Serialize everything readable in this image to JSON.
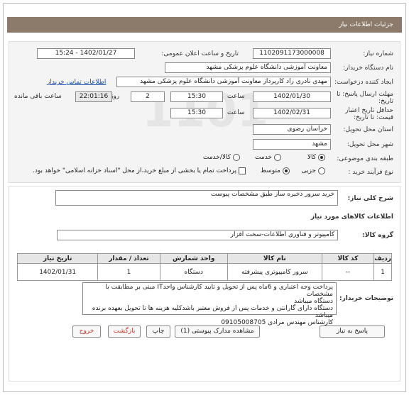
{
  "header": {
    "title": "جزئیات اطلاعات نیاز"
  },
  "form": {
    "need_number": {
      "label": "شماره نیاز:",
      "value": "1102091173000008"
    },
    "announce": {
      "label": "تاریخ و ساعت اعلان عمومی:",
      "value": "1402/01/27 - 15:24"
    },
    "buyer": {
      "label": "نام دستگاه خریدار:",
      "value": "معاونت آموزشی دانشگاه علوم پزشکی مشهد"
    },
    "creator": {
      "label": "ایجاد کننده درخواست:",
      "value": "مهدی نادری راد کارپرداز معاونت آموزشی دانشگاه علوم پزشکی مشهد",
      "contact_link": "اطلاعات تماس خریدار"
    },
    "deadline": {
      "label": "مهلت ارسال پاسخ: تا تاریخ:",
      "date": "1402/01/30",
      "time_label": "ساعت",
      "time": "15:30",
      "days": "2",
      "days_label": "روز و",
      "remaining": "22:01:16",
      "remaining_label": "ساعت باقی مانده"
    },
    "validity": {
      "label": "حداقل تاریخ اعتبار قیمت: تا تاریخ:",
      "date": "1402/02/31",
      "time_label": "ساعت",
      "time": "15:30"
    },
    "province": {
      "label": "استان محل تحویل:",
      "value": "خراسان رضوی"
    },
    "city": {
      "label": "شهر محل تحویل:",
      "value": "مشهد"
    },
    "category": {
      "label": "طبقه بندی موضوعی:",
      "options": [
        "کالا",
        "خدمت",
        "کالا/خدمت"
      ]
    },
    "process": {
      "label": "نوع فرآیند خرید :",
      "options": [
        "جزیی",
        "متوسط"
      ],
      "payment_note": "پرداخت تمام یا بخشی از مبلغ خرید،از محل \"اسناد خزانه اسلامی\" خواهد بود."
    }
  },
  "summary": {
    "label": "شرح کلی نیاز:",
    "value": "خرید سرور ذخیره ساز طبق مشخصات پیوست"
  },
  "goods": {
    "section_title": "اطلاعات کالاهای مورد نیاز",
    "group_label": "گروه کالا:",
    "group_value": "کامپیوتر و فناوری اطلاعات-سخت افزار",
    "columns": [
      "ردیف",
      "کد کالا",
      "نام کالا",
      "واحد شمارش",
      "تعداد / مقدار",
      "تاریخ نیاز"
    ],
    "rows": [
      {
        "row": "1",
        "code": "--",
        "name": "سرور کامپیوتری پیشرفته",
        "unit": "دستگاه",
        "qty": "1",
        "date": "1402/01/31"
      }
    ]
  },
  "buyer_notes": {
    "label": "توضیحات خریدار:",
    "lines": [
      "پرداخت وجه اعتباری و 6ماه پس از تحویل و تایید کارشناس واحدIT مبنی بر مطابقت با مشخصات",
      "دستگاه میباشد",
      "دستگاه دارای گارانتی و خدمات پس از فروش معتبر باشدکلیه هزینه ها تا تحویل بعهده برنده میباشد",
      "کارشناس مهندس مرادی 09105008705"
    ]
  },
  "buttons": {
    "reply": "پاسخ به نیاز",
    "attachments": "مشاهده مدارک پیوستی (1)",
    "print": "چاپ",
    "back": "بازگشت",
    "exit": "خروج"
  }
}
